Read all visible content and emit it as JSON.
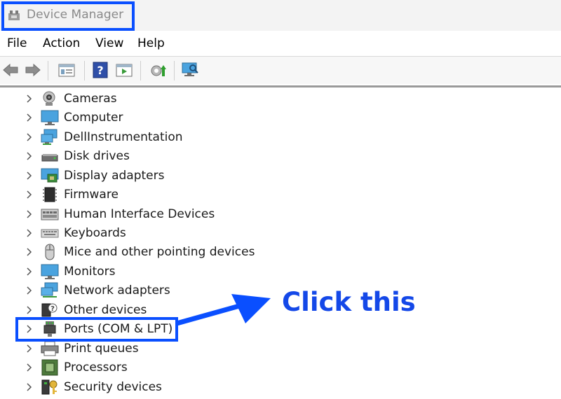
{
  "window": {
    "title": "Device Manager",
    "title_icon": "device-manager-icon"
  },
  "menu": [
    {
      "label": "File"
    },
    {
      "label": "Action"
    },
    {
      "label": "View"
    },
    {
      "label": "Help"
    }
  ],
  "toolbar": {
    "buttons": [
      "back-icon",
      "forward-icon",
      "properties-icon",
      "help-icon",
      "update-driver-icon",
      "enable-device-icon",
      "scan-hardware-icon"
    ]
  },
  "tree": {
    "items": [
      {
        "label": "Cameras",
        "icon": "camera-icon"
      },
      {
        "label": "Computer",
        "icon": "computer-icon"
      },
      {
        "label": "DellInstrumentation",
        "icon": "network-computer-icon"
      },
      {
        "label": "Disk drives",
        "icon": "disk-drive-icon"
      },
      {
        "label": "Display adapters",
        "icon": "display-adapter-icon"
      },
      {
        "label": "Firmware",
        "icon": "firmware-chip-icon"
      },
      {
        "label": "Human Interface Devices",
        "icon": "hid-keyboard-icon"
      },
      {
        "label": "Keyboards",
        "icon": "keyboard-icon"
      },
      {
        "label": "Mice and other pointing devices",
        "icon": "mouse-icon"
      },
      {
        "label": "Monitors",
        "icon": "monitor-icon"
      },
      {
        "label": "Network adapters",
        "icon": "network-adapter-icon"
      },
      {
        "label": "Other devices",
        "icon": "unknown-device-icon"
      },
      {
        "label": "Ports (COM & LPT)",
        "icon": "port-connector-icon"
      },
      {
        "label": "Print queues",
        "icon": "printer-icon"
      },
      {
        "label": "Processors",
        "icon": "processor-icon"
      },
      {
        "label": "Security devices",
        "icon": "security-key-icon"
      }
    ]
  },
  "annotation": {
    "callout": "Click this",
    "color": "#1448e8"
  }
}
